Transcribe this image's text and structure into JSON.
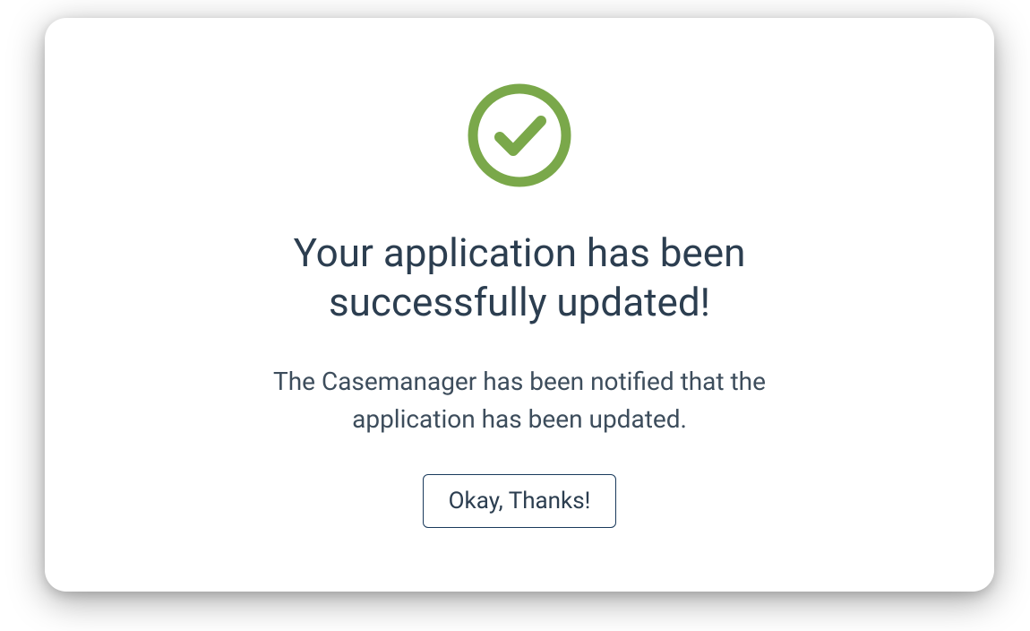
{
  "modal": {
    "icon": "checkmark-circle-icon",
    "title": "Your application has been successfully updated!",
    "message": "The Casemanager has been notified that the application has been updated.",
    "confirm_label": "Okay, Thanks!",
    "colors": {
      "accent_green": "#7aa84a",
      "text_primary": "#2c3e50",
      "text_secondary": "#3d4d5c",
      "button_border": "#1a3a5c"
    }
  }
}
